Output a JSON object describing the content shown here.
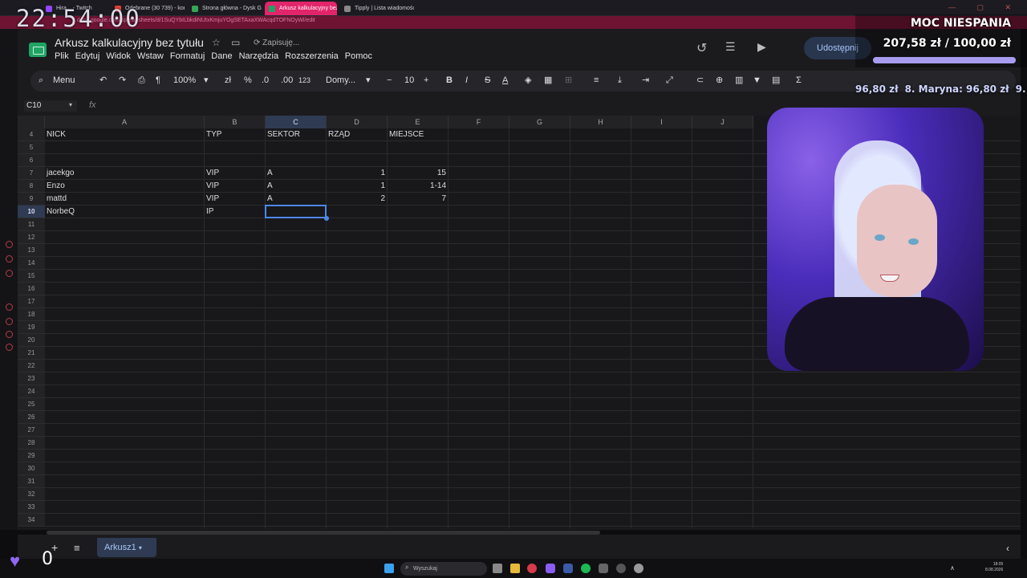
{
  "overlay_clock": "22:54:00",
  "browser_tabs": [
    {
      "label": "Hira... - Twitch",
      "color": "#9146ff"
    },
    {
      "label": "Odebrane (30 739) - konta",
      "color": "#ea4335"
    },
    {
      "label": "Strona główna - Dysk Goo",
      "color": "#34a853"
    },
    {
      "label": "Arkusz kalkulacyjny bez t",
      "color": "#1fa463"
    },
    {
      "label": "Tipply | Lista wiadomości",
      "color": "#888888"
    }
  ],
  "address": "docs.google.com/spreadsheets/d/1SuQYbILbkdiNUtxKmjuYOgSETAxaXWAcqdTOFNOyWi/edit",
  "doc": {
    "title": "Arkusz kalkulacyjny bez tytułu",
    "status": "Zapisuję..."
  },
  "menu": [
    "Plik",
    "Edytuj",
    "Widok",
    "Wstaw",
    "Formatuj",
    "Dane",
    "Narzędzia",
    "Rozszerzenia",
    "Pomoc"
  ],
  "toolbar": {
    "menu_label": "Menu",
    "zoom": "100%",
    "currency": "zł",
    "percent": "%",
    "dec_less": ".0",
    "dec_more": ".00",
    "num_format": "123",
    "font": "Domy...",
    "font_size": "10",
    "bold": "B",
    "italic": "I",
    "strike": "S",
    "textcolor": "A"
  },
  "share_label": "Udostępnij",
  "namebox": "C10",
  "fx": "fx",
  "grid": {
    "columns": [
      "A",
      "B",
      "C",
      "D",
      "E",
      "F",
      "G",
      "H",
      "I",
      "J"
    ],
    "rows": [
      "4",
      "5",
      "6",
      "7",
      "8",
      "9",
      "10",
      "11",
      "12",
      "13",
      "14",
      "15",
      "16",
      "17",
      "18",
      "19",
      "20",
      "21",
      "22",
      "23",
      "24",
      "25",
      "26",
      "27",
      "28",
      "29",
      "30",
      "31",
      "32",
      "33",
      "34"
    ],
    "selected_col": "C",
    "selected_row": "10",
    "cells": [
      {
        "row": "4",
        "col": "A",
        "v": "NICK"
      },
      {
        "row": "4",
        "col": "B",
        "v": "TYP"
      },
      {
        "row": "4",
        "col": "C",
        "v": "SEKTOR"
      },
      {
        "row": "4",
        "col": "D",
        "v": "RZĄD"
      },
      {
        "row": "4",
        "col": "E",
        "v": "MIEJSCE"
      },
      {
        "row": "7",
        "col": "A",
        "v": "jacekgo"
      },
      {
        "row": "7",
        "col": "B",
        "v": "VIP"
      },
      {
        "row": "7",
        "col": "C",
        "v": "A"
      },
      {
        "row": "7",
        "col": "D",
        "v": "1",
        "num": true
      },
      {
        "row": "7",
        "col": "E",
        "v": "15",
        "num": true
      },
      {
        "row": "8",
        "col": "A",
        "v": "Enzo"
      },
      {
        "row": "8",
        "col": "B",
        "v": "VIP"
      },
      {
        "row": "8",
        "col": "C",
        "v": "A"
      },
      {
        "row": "8",
        "col": "D",
        "v": "1",
        "num": true
      },
      {
        "row": "8",
        "col": "E",
        "v": "1-14",
        "num": true
      },
      {
        "row": "9",
        "col": "A",
        "v": "mattd"
      },
      {
        "row": "9",
        "col": "B",
        "v": "VIP"
      },
      {
        "row": "9",
        "col": "C",
        "v": "A"
      },
      {
        "row": "9",
        "col": "D",
        "v": "2",
        "num": true
      },
      {
        "row": "9",
        "col": "E",
        "v": "7",
        "num": true
      },
      {
        "row": "10",
        "col": "A",
        "v": "NorbeQ"
      },
      {
        "row": "10",
        "col": "B",
        "v": "IP"
      }
    ]
  },
  "sheet_tab": "Arkusz1",
  "taskbar_search": "Wyszukaj",
  "tray": {
    "time": "18:05",
    "date": "8.08.2026"
  },
  "stream": {
    "goal_title": "MOC NIESPANIA",
    "goal_amount": "207,58 zł / 100,00 zł",
    "goal_progress": 1.0,
    "ticker": [
      "96,80 zł",
      "8. Maryna: 96,80 zł",
      "9."
    ],
    "heart_count": "0"
  },
  "colors": {
    "accent": "#4e86e8",
    "brand": "#1fa463",
    "stream": "#8f67f4"
  }
}
